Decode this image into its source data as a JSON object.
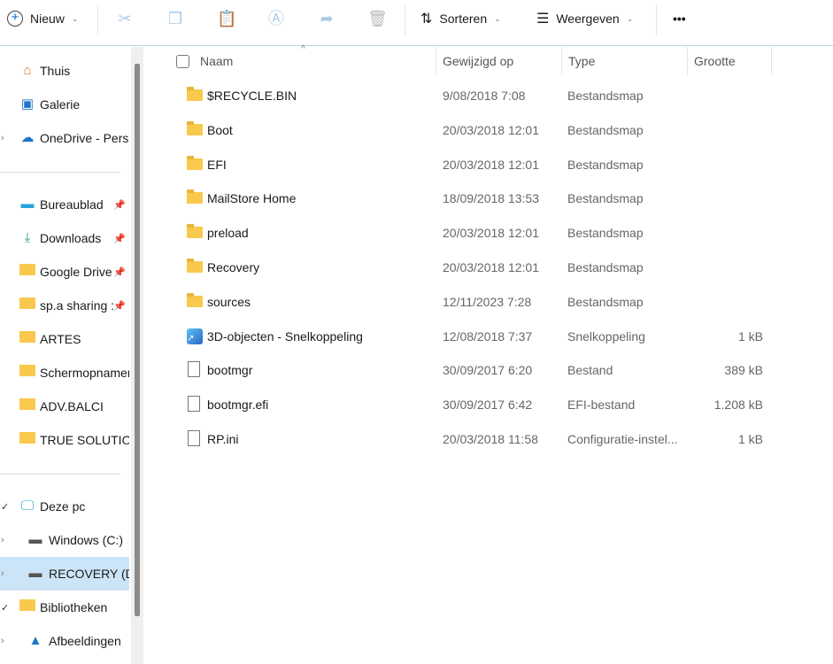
{
  "toolbar": {
    "new_label": "Nieuw",
    "sort_label": "Sorteren",
    "view_label": "Weergeven",
    "more": "•••",
    "accent": "#0067c0"
  },
  "sidebar": {
    "items": [
      {
        "label": "Thuis",
        "icon": "home-icon"
      },
      {
        "label": "Galerie",
        "icon": "gallery-icon"
      },
      {
        "label": "OneDrive - Persoonlijk",
        "icon": "cloud-icon"
      },
      {
        "label": "Bureaublad",
        "icon": "desktop-icon"
      },
      {
        "label": "Downloads",
        "icon": "download-icon"
      },
      {
        "label": "Google Drive",
        "icon": "folder-icon"
      },
      {
        "label": "sp.a sharing :",
        "icon": "folder-icon"
      },
      {
        "label": "ARTES",
        "icon": "folder-icon"
      },
      {
        "label": "Schermopnamen",
        "icon": "folder-icon"
      },
      {
        "label": "ADV.BALCI",
        "icon": "folder-icon"
      },
      {
        "label": "TRUE SOLUTIONS",
        "icon": "folder-icon"
      },
      {
        "label": "Deze pc",
        "icon": "pc-icon"
      },
      {
        "label": "Windows (C:)",
        "icon": "drive-icon"
      },
      {
        "label": "RECOVERY (D:)",
        "icon": "drive-icon"
      },
      {
        "label": "Bibliotheken",
        "icon": "folder-icon"
      },
      {
        "label": "Afbeeldingen",
        "icon": "pictures-icon"
      }
    ]
  },
  "columns": {
    "name": "Naam",
    "modified": "Gewijzigd op",
    "type": "Type",
    "size": "Grootte"
  },
  "files": [
    {
      "name": "$RECYCLE.BIN",
      "modified": "9/08/2018 7:08",
      "type": "Bestandsmap",
      "size": "",
      "kind": "folder"
    },
    {
      "name": "Boot",
      "modified": "20/03/2018 12:01",
      "type": "Bestandsmap",
      "size": "",
      "kind": "folder"
    },
    {
      "name": "EFI",
      "modified": "20/03/2018 12:01",
      "type": "Bestandsmap",
      "size": "",
      "kind": "folder"
    },
    {
      "name": "MailStore Home",
      "modified": "18/09/2018 13:53",
      "type": "Bestandsmap",
      "size": "",
      "kind": "folder"
    },
    {
      "name": "preload",
      "modified": "20/03/2018 12:01",
      "type": "Bestandsmap",
      "size": "",
      "kind": "folder"
    },
    {
      "name": "Recovery",
      "modified": "20/03/2018 12:01",
      "type": "Bestandsmap",
      "size": "",
      "kind": "folder"
    },
    {
      "name": "sources",
      "modified": "12/11/2023 7:28",
      "type": "Bestandsmap",
      "size": "",
      "kind": "folder"
    },
    {
      "name": "3D-objecten - Snelkoppeling",
      "modified": "12/08/2018 7:37",
      "type": "Snelkoppeling",
      "size": "1 kB",
      "kind": "shortcut"
    },
    {
      "name": "bootmgr",
      "modified": "30/09/2017 6:20",
      "type": "Bestand",
      "size": "389 kB",
      "kind": "file"
    },
    {
      "name": "bootmgr.efi",
      "modified": "30/09/2017 6:42",
      "type": "EFI-bestand",
      "size": "1.208 kB",
      "kind": "file"
    },
    {
      "name": "RP.ini",
      "modified": "20/03/2018 11:58",
      "type": "Configuratie-instel...",
      "size": "1 kB",
      "kind": "ini"
    }
  ]
}
